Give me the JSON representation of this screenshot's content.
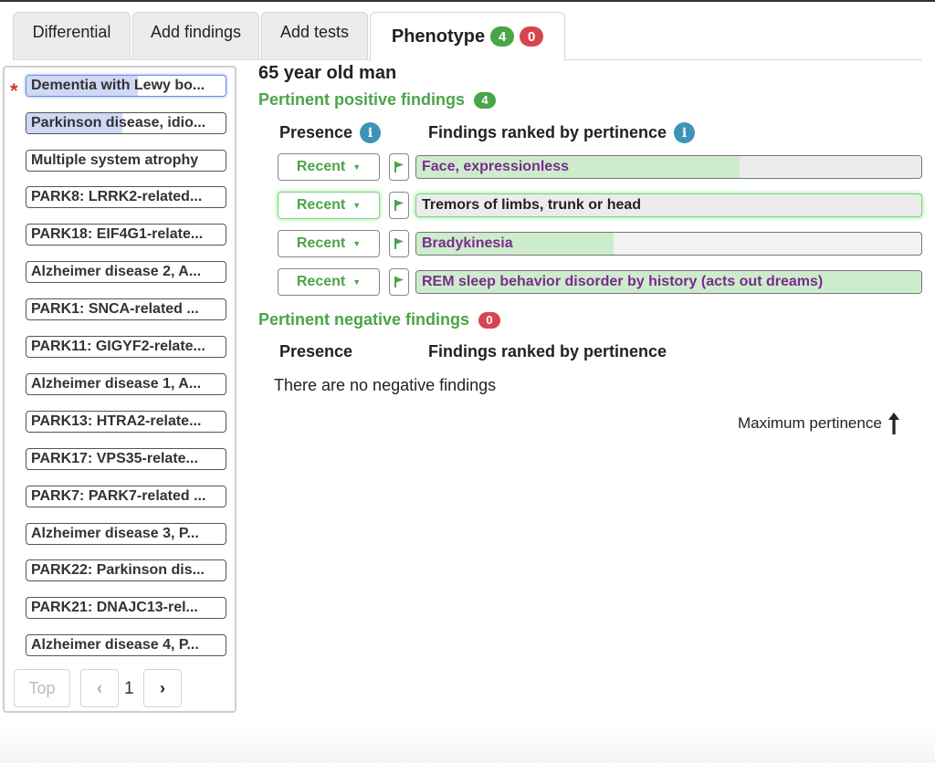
{
  "tabs": {
    "differential": "Differential",
    "add_findings": "Add findings",
    "add_tests": "Add tests",
    "phenotype": "Phenotype",
    "phenotype_pos_count": "4",
    "phenotype_neg_count": "0"
  },
  "sidebar": {
    "required_marker": "*",
    "items": [
      {
        "label": "Dementia with Lewy bo...",
        "score": 0.56
      },
      {
        "label": "Parkinson disease, idio...",
        "score": 0.48
      },
      {
        "label": "Multiple system atrophy",
        "score": 0
      },
      {
        "label": "PARK8: LRRK2-related...",
        "score": 0
      },
      {
        "label": "PARK18: EIF4G1-relate...",
        "score": 0
      },
      {
        "label": "Alzheimer disease 2, A...",
        "score": 0
      },
      {
        "label": "PARK1: SNCA-related ...",
        "score": 0
      },
      {
        "label": "PARK11: GIGYF2-relate...",
        "score": 0
      },
      {
        "label": "Alzheimer disease 1, A...",
        "score": 0
      },
      {
        "label": "PARK13: HTRA2-relate...",
        "score": 0
      },
      {
        "label": "PARK17: VPS35-relate...",
        "score": 0
      },
      {
        "label": "PARK7: PARK7-related ...",
        "score": 0
      },
      {
        "label": "Alzheimer disease 3, P...",
        "score": 0
      },
      {
        "label": "PARK22: Parkinson dis...",
        "score": 0
      },
      {
        "label": "PARK21: DNAJC13-rel...",
        "score": 0
      },
      {
        "label": "Alzheimer disease 4, P...",
        "score": 0
      }
    ],
    "pager": {
      "top": "Top",
      "prev": "‹",
      "page": "1",
      "next": "›"
    }
  },
  "main": {
    "title": "65 year old man",
    "positive": {
      "heading": "Pertinent positive findings",
      "count": "4",
      "col_presence": "Presence",
      "col_findings": "Findings ranked by pertinence",
      "info_glyph": "i",
      "rows": [
        {
          "presence": "Recent",
          "finding": "Face, expressionless",
          "pertinence": 0.64
        },
        {
          "presence": "Recent",
          "finding": "Tremors of limbs, trunk or head",
          "pertinence": 0
        },
        {
          "presence": "Recent",
          "finding": "Bradykinesia",
          "pertinence": 0.39
        },
        {
          "presence": "Recent",
          "finding": "REM sleep behavior disorder by history (acts out dreams)",
          "pertinence": 1.0
        }
      ]
    },
    "negative": {
      "heading": "Pertinent negative findings",
      "count": "0",
      "col_presence": "Presence",
      "col_findings": "Findings ranked by pertinence",
      "empty_text": "There are no negative findings"
    },
    "max_pertinence_label": "Maximum pertinence"
  },
  "colors": {
    "accent_green": "#4aa548",
    "badge_red": "#d64550",
    "info_blue": "#3d94b8",
    "finding_purple": "#7a2b8f",
    "dx_fill_blue": "#cfd8f5",
    "finding_fill_green": "#cdeccb"
  },
  "icons": {
    "flag": "flag-icon",
    "info": "info-icon",
    "caret": "caret-down-icon",
    "arrow": "arrow-up-icon"
  }
}
